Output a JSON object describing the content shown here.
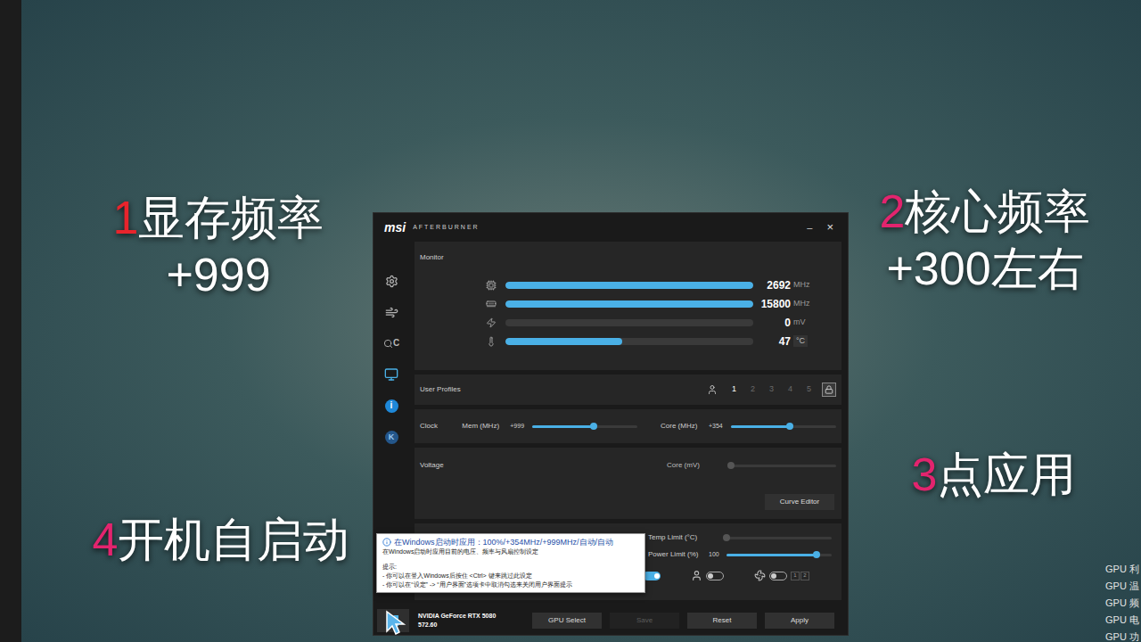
{
  "overlays": [
    {
      "number": "1",
      "text": "显存频率",
      "sub": "+999",
      "color": "#e8242c"
    },
    {
      "number": "2",
      "text": "核心频率",
      "sub": "+300左右",
      "color": "#e3246e"
    },
    {
      "number": "3",
      "text": "点应用",
      "color": "#e3246e"
    },
    {
      "number": "4",
      "text": "开机自启动",
      "color": "#e3246e"
    }
  ],
  "side_readouts": [
    "GPU 利",
    "GPU 温",
    "GPU 频",
    "GPU 电",
    "GPU 功"
  ],
  "window": {
    "logo": "msi",
    "title": "AFTERBURNER",
    "minimize": "–",
    "close": "×"
  },
  "sidebar": [
    {
      "kind": "settings",
      "selected": false
    },
    {
      "kind": "kboost",
      "selected": false
    },
    {
      "kind": "scanner",
      "glyph": "C",
      "selected": false
    },
    {
      "kind": "monitor",
      "selected": true
    },
    {
      "kind": "info",
      "glyph": "i",
      "selected": false
    },
    {
      "kind": "skin",
      "glyph": "K",
      "selected": false
    }
  ],
  "monitor": {
    "title": "Monitor",
    "rows": [
      {
        "kind": "core",
        "level": 1,
        "value": "2692",
        "unit": "MHz"
      },
      {
        "kind": "memory",
        "level": 1,
        "value": "15800",
        "unit": "MHz"
      },
      {
        "kind": "voltage",
        "level": 0,
        "value": "0",
        "unit": "mV"
      },
      {
        "kind": "temperature",
        "level": 0.47,
        "value": "47",
        "unit": "°C"
      }
    ]
  },
  "profiles": {
    "label": "User Profiles",
    "slots": [
      {
        "label": "1",
        "selected": true
      },
      {
        "label": "2",
        "selected": false
      },
      {
        "label": "3",
        "selected": false
      },
      {
        "label": "4",
        "selected": false
      },
      {
        "label": "5",
        "selected": false
      }
    ],
    "locked": true
  },
  "clock": {
    "label": "Clock",
    "sliders": [
      {
        "label": "Mem (MHz)",
        "value": "+999",
        "level": 0.58,
        "disabled": false
      },
      {
        "label": "Core (MHz)",
        "value": "+354",
        "level": 0.56,
        "disabled": false
      }
    ]
  },
  "voltage": {
    "label": "Voltage",
    "slider": {
      "label": "Core (mV)",
      "level": 0,
      "disabled": true
    },
    "button": "Curve Editor"
  },
  "limits": {
    "sliders": [
      {
        "label": "Temp Limit (°C)",
        "level": 0,
        "disabled": true
      },
      {
        "label": "Power Limit (%)",
        "value": "100",
        "level": 0.86,
        "disabled": false
      }
    ],
    "startup_toggle": {
      "on": true
    },
    "user_toggle": {
      "on": false
    },
    "fan_toggle": {
      "on": false
    },
    "fan_profiles": [
      {
        "label": "1",
        "selected": false
      },
      {
        "label": "2",
        "selected": false
      }
    ]
  },
  "tooltip": {
    "title": "在Windows启动时应用：100%/+354MHz/+999MHz/自动/自动",
    "description": "在Windows启动时应用目前的电压、频率与风扇控制设定",
    "hint_title": "提示:",
    "hints": [
      "- 你可以在登入Windows后按住 <Ctrl> 键来跳过此设定",
      "- 你可以在“设定” -> “用户界面”选项卡中取消勾选来关闭用户界面提示"
    ]
  },
  "footer": {
    "startup": {
      "selected": true
    },
    "gpu_name": "NVIDIA GeForce RTX 5080",
    "driver": "572.60",
    "buttons": [
      {
        "label": "GPU Select",
        "disabled": false
      },
      {
        "label": "Save",
        "disabled": true
      },
      {
        "label": "Reset",
        "disabled": false
      },
      {
        "label": "Apply",
        "disabled": false
      }
    ]
  }
}
